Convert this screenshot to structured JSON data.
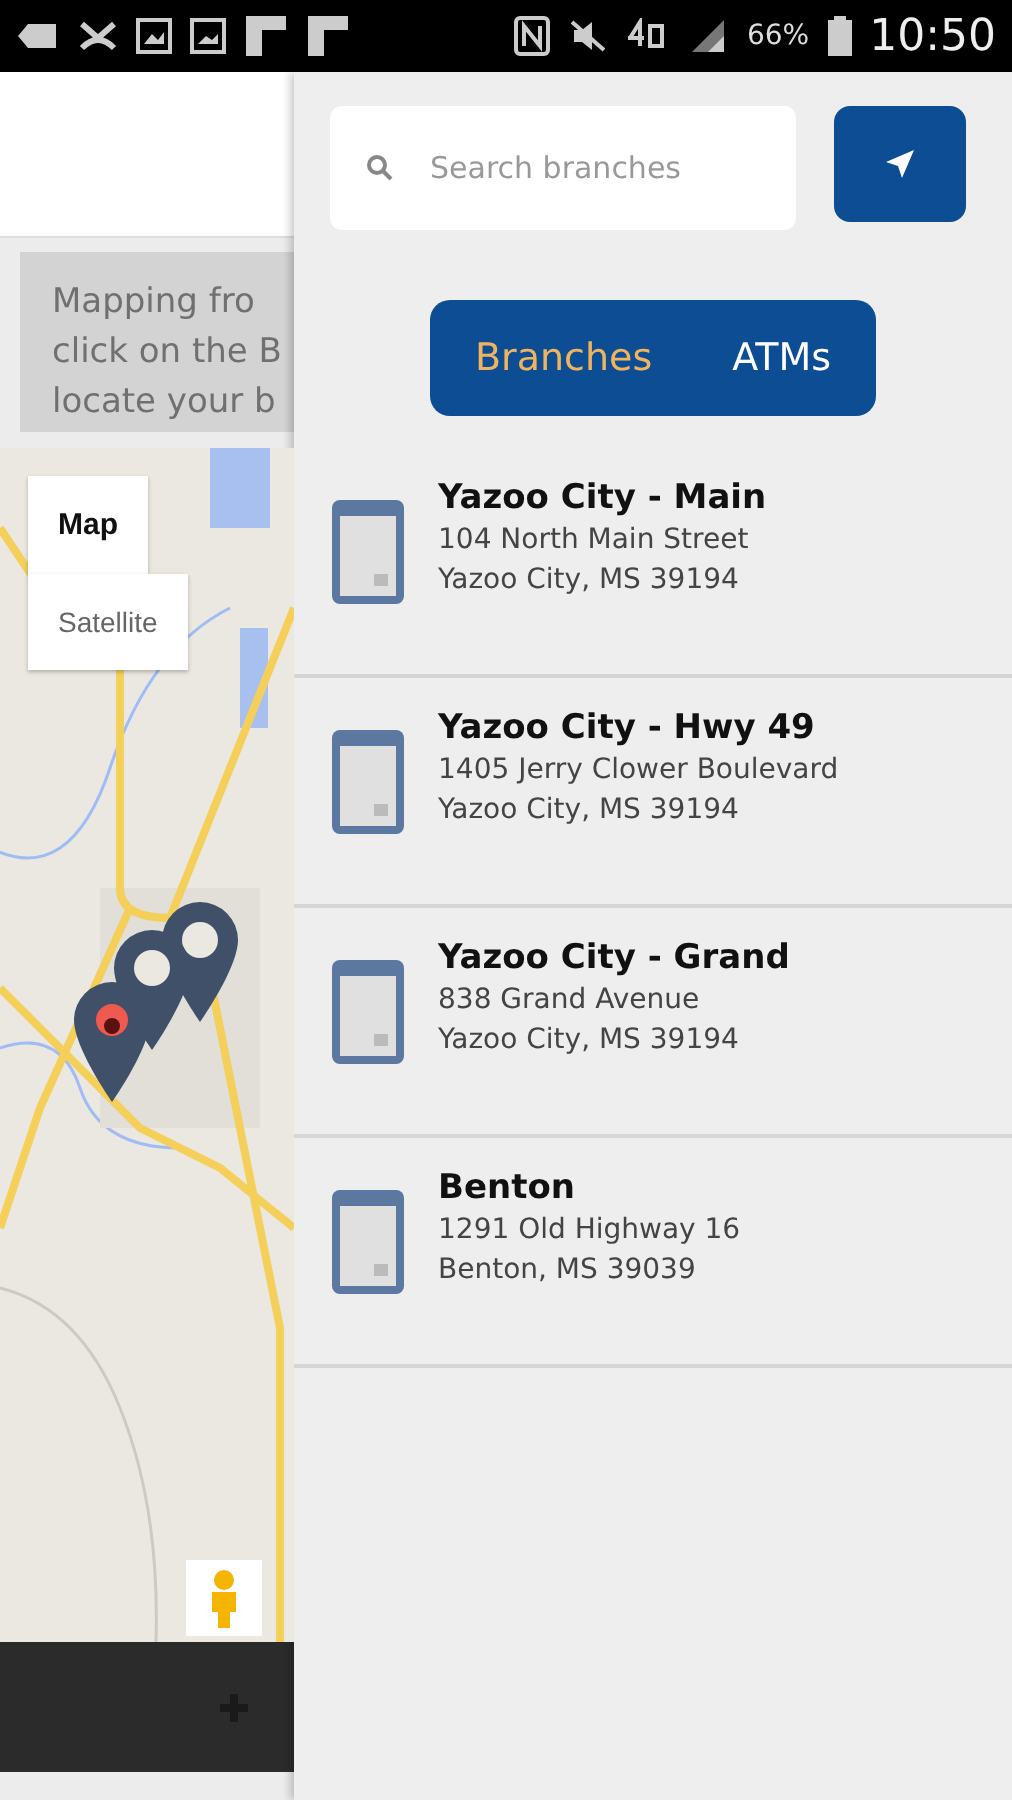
{
  "status_bar": {
    "battery": "66%",
    "time": "10:50"
  },
  "page": {
    "notice_lines": [
      "Mapping fro",
      "click on the B",
      "locate your b"
    ],
    "map": {
      "type_buttons": [
        {
          "label": "Map",
          "selected": true
        },
        {
          "label": "Satellite",
          "selected": false
        }
      ]
    }
  },
  "search": {
    "placeholder": "Search branches"
  },
  "toggle": [
    {
      "label": "Branches",
      "selected": true
    },
    {
      "label": "ATMs",
      "selected": false
    }
  ],
  "branches": [
    {
      "name": "Yazoo City - Main",
      "street": "104 North Main Street",
      "city": "Yazoo City, MS 39194"
    },
    {
      "name": "Yazoo City - Hwy 49",
      "street": "1405 Jerry Clower Boulevard",
      "city": "Yazoo City, MS 39194"
    },
    {
      "name": "Yazoo City - Grand",
      "street": "838 Grand Avenue",
      "city": "Yazoo City, MS 39194"
    },
    {
      "name": "Benton",
      "street": "1291 Old Highway 16",
      "city": "Benton, MS 39039"
    }
  ]
}
